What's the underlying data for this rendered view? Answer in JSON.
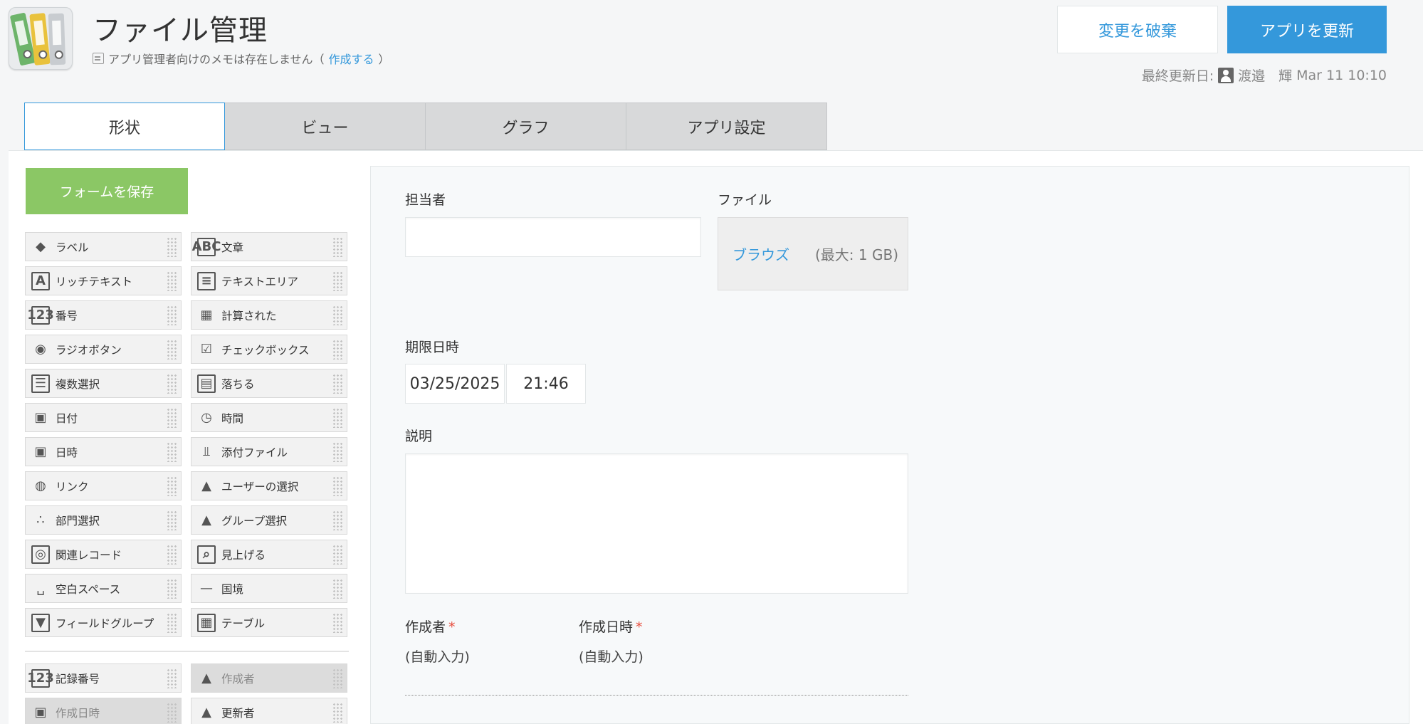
{
  "header": {
    "app_title": "ファイル管理",
    "memo_text": "アプリ管理者向けのメモは存在しません（",
    "memo_link": "作成する",
    "memo_close": "）",
    "discard_label": "変更を破棄",
    "update_label": "アプリを更新",
    "last_updated_label": "最終更新日:",
    "last_updated_user": "渡邉　輝",
    "last_updated_time": "Mar 11 10:10"
  },
  "tabs": [
    {
      "label": "形状",
      "active": true
    },
    {
      "label": "ビュー",
      "active": false
    },
    {
      "label": "グラフ",
      "active": false
    },
    {
      "label": "アプリ設定",
      "active": false
    }
  ],
  "palette": {
    "save_label": "フォームを保存",
    "items": [
      {
        "label": "ラベル",
        "icon": "tag-icon"
      },
      {
        "label": "文章",
        "icon": "abc-icon"
      },
      {
        "label": "リッチテキスト",
        "icon": "rich-text-icon"
      },
      {
        "label": "テキストエリア",
        "icon": "text-area-icon"
      },
      {
        "label": "番号",
        "icon": "number-icon"
      },
      {
        "label": "計算された",
        "icon": "calculator-icon"
      },
      {
        "label": "ラジオボタン",
        "icon": "radio-icon"
      },
      {
        "label": "チェックボックス",
        "icon": "checkbox-icon"
      },
      {
        "label": "複数選択",
        "icon": "multi-select-icon"
      },
      {
        "label": "落ちる",
        "icon": "dropdown-icon"
      },
      {
        "label": "日付",
        "icon": "calendar-icon"
      },
      {
        "label": "時間",
        "icon": "clock-icon"
      },
      {
        "label": "日時",
        "icon": "datetime-icon"
      },
      {
        "label": "添付ファイル",
        "icon": "paperclip-icon"
      },
      {
        "label": "リンク",
        "icon": "globe-icon"
      },
      {
        "label": "ユーザーの選択",
        "icon": "user-icon"
      },
      {
        "label": "部門選択",
        "icon": "org-chart-icon"
      },
      {
        "label": "グループ選択",
        "icon": "group-icon"
      },
      {
        "label": "関連レコード",
        "icon": "related-records-icon"
      },
      {
        "label": "見上げる",
        "icon": "lookup-icon"
      },
      {
        "label": "空白スペース",
        "icon": "blank-space-icon"
      },
      {
        "label": "国境",
        "icon": "border-line-icon"
      },
      {
        "label": "フィールドグループ",
        "icon": "field-group-icon"
      },
      {
        "label": "テーブル",
        "icon": "table-icon"
      }
    ],
    "system_items": [
      {
        "label": "記録番号",
        "icon": "number-icon",
        "disabled": false
      },
      {
        "label": "作成者",
        "icon": "user-icon",
        "disabled": true
      },
      {
        "label": "作成日時",
        "icon": "datetime-icon",
        "disabled": true
      },
      {
        "label": "更新者",
        "icon": "user-icon",
        "disabled": false
      }
    ]
  },
  "form": {
    "assignee_label": "担当者",
    "file_label": "ファイル",
    "file_browse": "ブラウズ",
    "file_max": "(最大: 1 GB)",
    "due_label": "期限日時",
    "due_date": "03/25/2025",
    "due_time": "21:46",
    "description_label": "説明",
    "creator_label": "作成者",
    "creator_value": "(自動入力)",
    "created_at_label": "作成日時",
    "created_at_value": "(自動入力)",
    "required_mark": "*"
  }
}
